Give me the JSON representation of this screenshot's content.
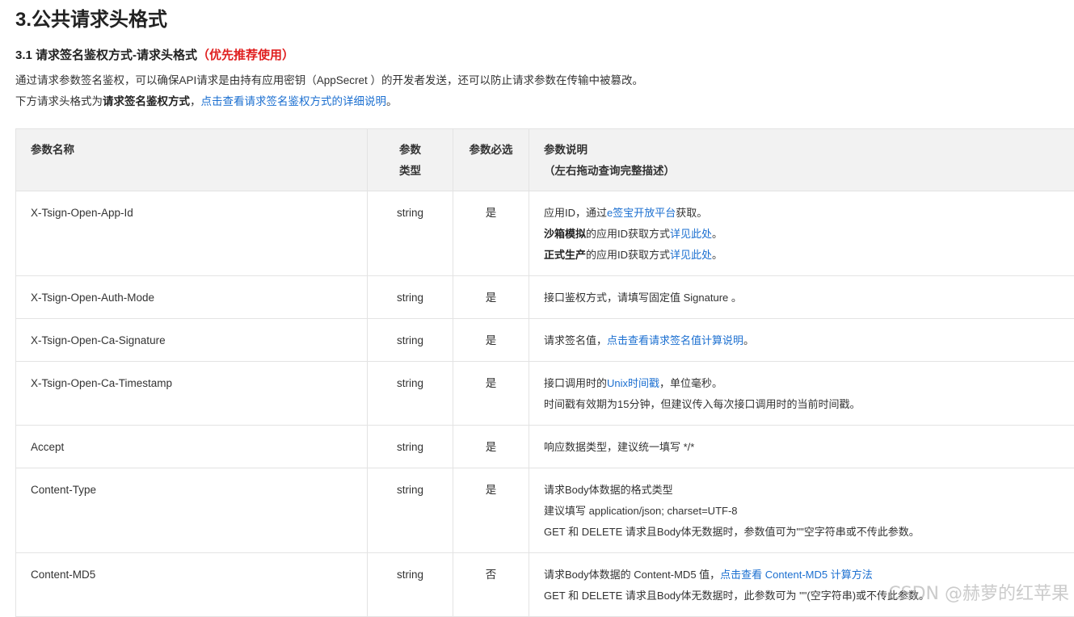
{
  "title": "3.公共请求头格式",
  "subtitle": {
    "text": "3.1 请求签名鉴权方式-请求头格式",
    "highlight": "（优先推荐使用）"
  },
  "intro": "通过请求参数签名鉴权，可以确保API请求是由持有应用密钥（AppSecret ）的开发者发送，还可以防止请求参数在传输中被篡改。",
  "intro2": {
    "prefix": "下方请求头格式为",
    "bold": "请求签名鉴权方式",
    "comma": "，",
    "link": "点击查看请求签名鉴权方式的详细说明",
    "suffix": "。"
  },
  "table": {
    "headers": {
      "name": "参数名称",
      "type_line1": "参数",
      "type_line2": "类型",
      "required": "参数必选",
      "desc_line1": "参数说明",
      "desc_line2": "（左右拖动查询完整描述）"
    },
    "rows": [
      {
        "name": "X-Tsign-Open-App-Id",
        "type": "string",
        "required": "是",
        "desc": {
          "l1_pre": "应用ID，通过",
          "l1_link": "e签宝开放平台",
          "l1_post": "获取。",
          "l2_bold": "沙箱模拟",
          "l2_mid": "的应用ID获取方式",
          "l2_link": "详见此处",
          "l2_post": "。",
          "l3_bold": "正式生产",
          "l3_mid": "的应用ID获取方式",
          "l3_link": "详见此处",
          "l3_post": "。"
        }
      },
      {
        "name": "X-Tsign-Open-Auth-Mode",
        "type": "string",
        "required": "是",
        "desc": {
          "l1": "接口鉴权方式，请填写固定值 Signature 。"
        }
      },
      {
        "name": "X-Tsign-Open-Ca-Signature",
        "type": "string",
        "required": "是",
        "desc": {
          "l1_pre": "请求签名值，",
          "l1_link": "点击查看请求签名值计算说明",
          "l1_post": "。"
        }
      },
      {
        "name": "X-Tsign-Open-Ca-Timestamp",
        "type": "string",
        "required": "是",
        "desc": {
          "l1_pre": "接口调用时的",
          "l1_link": "Unix时间戳",
          "l1_post": "，单位毫秒。",
          "l2": "时间戳有效期为15分钟，但建议传入每次接口调用时的当前时间戳。"
        }
      },
      {
        "name": "Accept",
        "type": "string",
        "required": "是",
        "desc": {
          "l1": "响应数据类型，建议统一填写 */*"
        }
      },
      {
        "name": "Content-Type",
        "type": "string",
        "required": "是",
        "desc": {
          "l1": "请求Body体数据的格式类型",
          "l2": "建议填写 application/json; charset=UTF-8",
          "l3": "GET 和 DELETE 请求且Body体无数据时，参数值可为\"\"空字符串或不传此参数。"
        }
      },
      {
        "name": "Content-MD5",
        "type": "string",
        "required": "否",
        "desc": {
          "l1_pre": "请求Body体数据的 Content-MD5 值，",
          "l1_link": "点击查看 Content-MD5 计算方法",
          "l2": "GET 和 DELETE 请求且Body体无数据时，此参数可为 \"\"(空字符串)或不传此参数。"
        }
      }
    ]
  },
  "watermark": "CSDN @赫萝的红苹果"
}
